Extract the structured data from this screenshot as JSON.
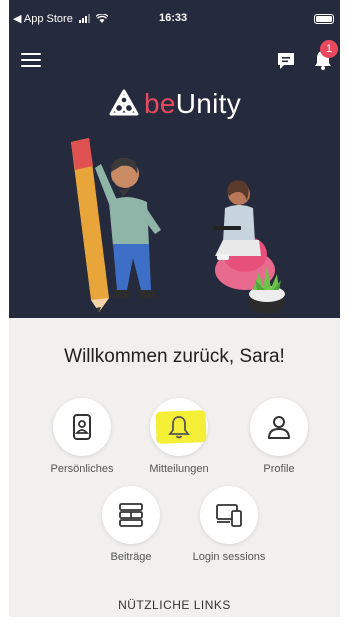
{
  "statusbar": {
    "back_label": "◀ App Store",
    "time": "16:33"
  },
  "header": {
    "notification_count": "1"
  },
  "brand": {
    "prefix": "be",
    "name": "Unity",
    "accent_color": "#e8495f",
    "hero_background": "#262a3d"
  },
  "welcome": {
    "text": "Willkommen zurück, Sara!"
  },
  "tiles": [
    {
      "label": "Persönliches",
      "icon": "id-card-icon"
    },
    {
      "label": "Mitteilungen",
      "icon": "bell-icon",
      "highlighted": true
    },
    {
      "label": "Profile",
      "icon": "user-icon"
    },
    {
      "label": "Beiträge",
      "icon": "posts-icon"
    },
    {
      "label": "Login sessions",
      "icon": "devices-icon"
    }
  ],
  "links": {
    "heading": "NÜTZLICHE LINKS"
  }
}
